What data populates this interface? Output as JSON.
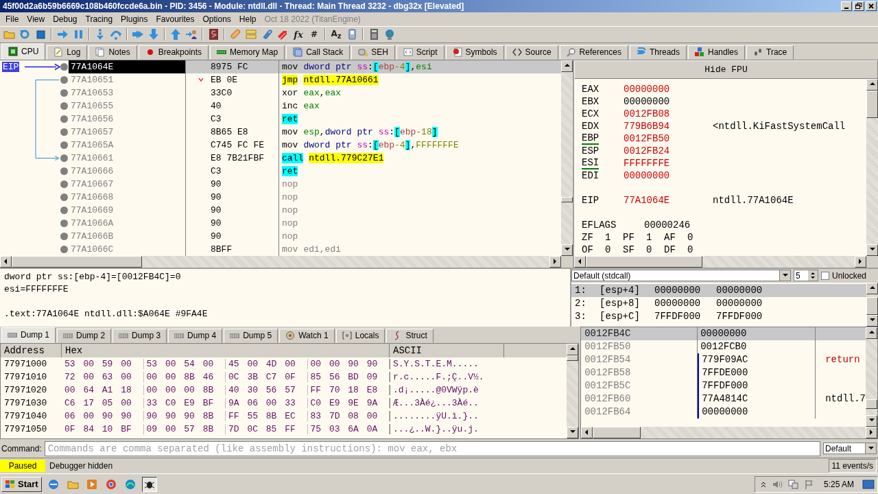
{
  "window": {
    "title": "45f00d2a6b59b6669c108b460fccde6a.bin - PID: 3456 - Module: ntdll.dll - Thread: Main Thread 3232 - dbg32x [Elevated]"
  },
  "menu": [
    "File",
    "View",
    "Debug",
    "Tracing",
    "Plugins",
    "Favourites",
    "Options",
    "Help"
  ],
  "build_info": "Oct 18 2022 (TitanEngine)",
  "toolbar": {
    "glyph_buttons": [
      "fx",
      "#",
      "A$_{z}$"
    ]
  },
  "tabs": [
    {
      "label": "CPU",
      "selected": true
    },
    {
      "label": "Log",
      "selected": false
    },
    {
      "label": "Notes",
      "selected": false
    },
    {
      "label": "Breakpoints",
      "selected": false
    },
    {
      "label": "Memory Map",
      "selected": false
    },
    {
      "label": "Call Stack",
      "selected": false
    },
    {
      "label": "SEH",
      "selected": false
    },
    {
      "label": "Script",
      "selected": false
    },
    {
      "label": "Symbols",
      "selected": false
    },
    {
      "label": "Source",
      "selected": false
    },
    {
      "label": "References",
      "selected": false
    },
    {
      "label": "Threads",
      "selected": false
    },
    {
      "label": "Handles",
      "selected": false
    },
    {
      "label": "Trace",
      "selected": false
    }
  ],
  "disassembly": {
    "eip_label": "EIP",
    "rows": [
      {
        "address": "77A1064E",
        "bytes": "8975 FC",
        "mnemonic": {
          "text": "mov",
          "kind": "plain"
        },
        "operands": [
          {
            "text": "dword ptr ",
            "kind": "size"
          },
          {
            "text": "ss",
            "kind": "seg"
          },
          {
            "text": ":",
            "kind": "punct"
          },
          {
            "text": "[",
            "kind": "bracket"
          },
          {
            "text": "ebp",
            "kind": "base"
          },
          {
            "text": "-4",
            "kind": "imm"
          },
          {
            "text": "]",
            "kind": "bracket"
          },
          {
            "text": ",",
            "kind": "punct"
          },
          {
            "text": "esi",
            "kind": "reg"
          }
        ],
        "selected": true,
        "jump_source": false,
        "jump_target": false
      },
      {
        "address": "77A10651",
        "bytes": "EB 0E",
        "mnemonic": {
          "text": "jmp",
          "kind": "jump"
        },
        "operands": [
          {
            "text": "ntdll.77A10661",
            "kind": "target"
          }
        ],
        "selected": false,
        "jump_source": true,
        "jump_target": false
      },
      {
        "address": "77A10653",
        "bytes": "33C0",
        "mnemonic": {
          "text": "xor",
          "kind": "plain"
        },
        "operands": [
          {
            "text": "eax",
            "kind": "reg"
          },
          {
            "text": ",",
            "kind": "punct"
          },
          {
            "text": "eax",
            "kind": "reg"
          }
        ],
        "selected": false,
        "jump_source": false,
        "jump_target": false
      },
      {
        "address": "77A10655",
        "bytes": "40",
        "mnemonic": {
          "text": "inc",
          "kind": "plain"
        },
        "operands": [
          {
            "text": "eax",
            "kind": "reg"
          }
        ],
        "selected": false,
        "jump_source": false,
        "jump_target": false
      },
      {
        "address": "77A10656",
        "bytes": "C3",
        "mnemonic": {
          "text": "ret",
          "kind": "ret"
        },
        "selected": false,
        "jump_source": false,
        "jump_target": false
      },
      {
        "address": "77A10657",
        "bytes": "8B65 E8",
        "mnemonic": {
          "text": "mov",
          "kind": "plain"
        },
        "operands": [
          {
            "text": "esp",
            "kind": "reg"
          },
          {
            "text": ",",
            "kind": "punct"
          },
          {
            "text": "dword ptr ",
            "kind": "size"
          },
          {
            "text": "ss",
            "kind": "seg"
          },
          {
            "text": ":",
            "kind": "punct"
          },
          {
            "text": "[",
            "kind": "bracket"
          },
          {
            "text": "ebp",
            "kind": "base"
          },
          {
            "text": "-18",
            "kind": "imm"
          },
          {
            "text": "]",
            "kind": "bracket"
          }
        ],
        "selected": false,
        "jump_source": false,
        "jump_target": false
      },
      {
        "address": "77A1065A",
        "bytes": "C745 FC FE",
        "mnemonic": {
          "text": "mov",
          "kind": "plain"
        },
        "operands": [
          {
            "text": "dword ptr ",
            "kind": "size"
          },
          {
            "text": "ss",
            "kind": "seg"
          },
          {
            "text": ":",
            "kind": "punct"
          },
          {
            "text": "[",
            "kind": "bracket"
          },
          {
            "text": "ebp",
            "kind": "base"
          },
          {
            "text": "-4",
            "kind": "imm"
          },
          {
            "text": "]",
            "kind": "bracket"
          },
          {
            "text": ",",
            "kind": "punct"
          },
          {
            "text": "FFFFFFFE",
            "kind": "imm"
          }
        ],
        "selected": false,
        "jump_source": false,
        "jump_target": false
      },
      {
        "address": "77A10661",
        "bytes": "E8 7B21FBF",
        "mnemonic": {
          "text": "call",
          "kind": "call"
        },
        "operands": [
          {
            "text": "ntdll.779C27E1",
            "kind": "target"
          }
        ],
        "selected": false,
        "jump_source": false,
        "jump_target": true
      },
      {
        "address": "77A10666",
        "bytes": "C3",
        "mnemonic": {
          "text": "ret",
          "kind": "ret"
        },
        "selected": false,
        "jump_source": false,
        "jump_target": false
      },
      {
        "address": "77A10667",
        "bytes": "90",
        "mnemonic": {
          "text": "nop",
          "kind": "filler"
        },
        "selected": false,
        "jump_source": false,
        "jump_target": false
      },
      {
        "address": "77A10668",
        "bytes": "90",
        "mnemonic": {
          "text": "nop",
          "kind": "filler"
        },
        "selected": false,
        "jump_source": false,
        "jump_target": false
      },
      {
        "address": "77A10669",
        "bytes": "90",
        "mnemonic": {
          "text": "nop",
          "kind": "filler"
        },
        "selected": false,
        "jump_source": false,
        "jump_target": false
      },
      {
        "address": "77A1066A",
        "bytes": "90",
        "mnemonic": {
          "text": "nop",
          "kind": "filler"
        },
        "selected": false,
        "jump_source": false,
        "jump_target": false
      },
      {
        "address": "77A1066B",
        "bytes": "90",
        "mnemonic": {
          "text": "nop",
          "kind": "filler"
        },
        "selected": false,
        "jump_source": false,
        "jump_target": false
      },
      {
        "address": "77A1066C",
        "bytes": "8BFF",
        "mnemonic": {
          "text": "mov",
          "kind": "filler"
        },
        "operands": [
          {
            "text": "edi,edi",
            "kind": "dim"
          }
        ],
        "selected": false,
        "jump_source": false,
        "jump_target": false
      }
    ]
  },
  "registers_pane": {
    "header_button": "Hide FPU",
    "registers": [
      {
        "name": "EAX",
        "value": "00000000",
        "changed": true,
        "underlined": false
      },
      {
        "name": "EBX",
        "value": "00000000",
        "changed": false,
        "underlined": false
      },
      {
        "name": "ECX",
        "value": "0012FB08",
        "changed": true,
        "underlined": false
      },
      {
        "name": "EDX",
        "value": "779B6B94",
        "changed": true,
        "underlined": false,
        "comment": "<ntdll.KiFastSystemCall"
      },
      {
        "name": "EBP",
        "value": "0012FB50",
        "changed": true,
        "underlined": true
      },
      {
        "name": "ESP",
        "value": "0012FB24",
        "changed": true,
        "underlined": false
      },
      {
        "name": "ESI",
        "value": "FFFFFFFE",
        "changed": true,
        "underlined": true
      },
      {
        "name": "EDI",
        "value": "00000000",
        "changed": true,
        "underlined": false
      }
    ],
    "instruction_pointer": {
      "name": "EIP",
      "value": "77A1064E",
      "changed": true,
      "comment": "ntdll.77A1064E"
    },
    "eflags": {
      "name": "EFLAGS",
      "value": "00000246"
    },
    "flags": [
      {
        "name": "ZF",
        "value": "1"
      },
      {
        "name": "PF",
        "value": "1"
      },
      {
        "name": "AF",
        "value": "0"
      },
      {
        "name": "OF",
        "value": "0"
      },
      {
        "name": "SF",
        "value": "0"
      },
      {
        "name": "DF",
        "value": "0"
      }
    ]
  },
  "info_pane": {
    "lines": [
      "dword ptr ss:[ebp-4]=[0012FB4C]=0",
      "esi=FFFFFFFE"
    ],
    "location": ".text:77A1064E ntdll.dll:$A064E #9FA4E"
  },
  "arguments_pane": {
    "convention": "Default (stdcall)",
    "count": "5",
    "unlocked": {
      "label": "Unlocked",
      "checked": false
    },
    "rows": [
      {
        "index": "1:",
        "slot": "[esp+4]",
        "value": "00000000",
        "value_2": "00000000",
        "selected": true
      },
      {
        "index": "2:",
        "slot": "[esp+8]",
        "value": "00000000",
        "value_2": "00000000",
        "selected": false
      },
      {
        "index": "3:",
        "slot": "[esp+C]",
        "value": "7FFDF000",
        "value_2": "7FFDF000",
        "selected": false
      }
    ]
  },
  "dump_tabs": [
    {
      "label": "Dump 1",
      "selected": true
    },
    {
      "label": "Dump 2",
      "selected": false
    },
    {
      "label": "Dump 3",
      "selected": false
    },
    {
      "label": "Dump 4",
      "selected": false
    },
    {
      "label": "Dump 5",
      "selected": false
    },
    {
      "label": "Watch 1",
      "selected": false
    },
    {
      "label": "Locals",
      "selected": false
    },
    {
      "label": "Struct",
      "selected": false
    }
  ],
  "dump": {
    "columns": [
      "Address",
      "Hex",
      "ASCII"
    ],
    "rows": [
      {
        "address": "77971000",
        "hex": [
          "53 00 59 00",
          "53 00 54 00",
          "45 00 4D 00",
          "00 00 90 90"
        ],
        "ascii": "S.Y.S.T.E.M....."
      },
      {
        "address": "77971010",
        "hex": [
          "72 00 63 00",
          "00 00 8B 46",
          "0C 3B C7 0F",
          "85 56 BD 09"
        ],
        "ascii": "r.c.....F.;Ç..V½."
      },
      {
        "address": "77971020",
        "hex": [
          "00 64 A1 18",
          "00 00 00 8B",
          "40 30 56 57",
          "FF 70 18 E8"
        ],
        "ascii": ".d¡.....@0VWÿp.è"
      },
      {
        "address": "77971030",
        "hex": [
          "C6 17 05 00",
          "33 C0 E9 BF",
          "9A 06 00 33",
          "C0 E9 9E 9A"
        ],
        "ascii": "Æ...3Àé¿...3Àé.."
      },
      {
        "address": "77971040",
        "hex": [
          "06 00 90 90",
          "90 90 90 8B",
          "FF 55 8B EC",
          "83 7D 08 00"
        ],
        "ascii": "........ÿU.ì.}.."
      },
      {
        "address": "77971050",
        "hex": [
          "0F 84 10 BF",
          "09 00 57 8B",
          "7D 0C 85 FF",
          "75 03 6A 0A"
        ],
        "ascii": "...¿..W.}..ÿu.j."
      }
    ]
  },
  "stack": {
    "rows": [
      {
        "address": "0012FB4C",
        "value": "00000000",
        "selected": true
      },
      {
        "address": "0012FB50",
        "value": "0012FCB0",
        "selected": false
      },
      {
        "address": "0012FB54",
        "value": "779F09AC",
        "selected": false,
        "comment": "return",
        "kind": "return"
      },
      {
        "address": "0012FB58",
        "value": "7FFDE000",
        "selected": false
      },
      {
        "address": "0012FB5C",
        "value": "7FFDF000",
        "selected": false
      },
      {
        "address": "0012FB60",
        "value": "77A4814C",
        "selected": false,
        "comment": "ntdll.7",
        "kind": "symbol"
      },
      {
        "address": "0012FB64",
        "value": "00000000",
        "selected": false
      }
    ]
  },
  "command_bar": {
    "label": "Command:",
    "placeholder": "Commands are comma separated (like assembly instructions): mov eax, ebx",
    "mode": "Default"
  },
  "status_bar": {
    "state": "Paused",
    "message": "Debugger hidden",
    "events": "11 events/s"
  },
  "taskbar": {
    "start": "Start",
    "time": "5:25 AM"
  }
}
